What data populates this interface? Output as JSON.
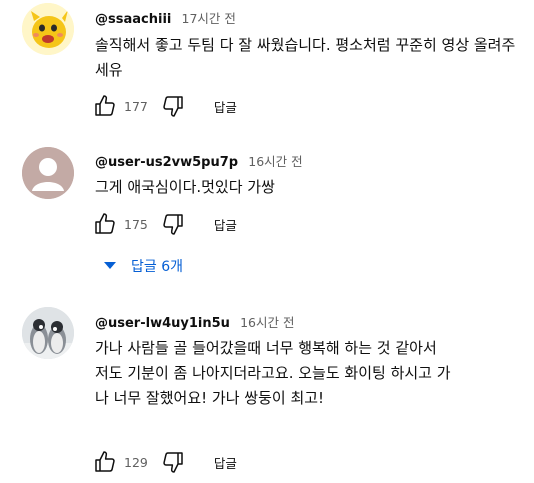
{
  "colors": {
    "link": "#065fd4",
    "secondary": "#606060",
    "text": "#0f0f0f"
  },
  "comments": [
    {
      "author": "@ssaachiii",
      "time": "17시간 전",
      "text": "솔직해서 좋고 두팀 다 잘 싸웠습니다. 평소처럼 꾸준히 영상 올려주세유",
      "likes": "177",
      "reply_label": "답글",
      "avatar": "cartoon-avatar"
    },
    {
      "author": "@user-us2vw5pu7p",
      "time": "16시간 전",
      "text": "그게 애국심이다.멋있다 가쌍",
      "likes": "175",
      "reply_label": "답글",
      "avatar": "default-avatar",
      "replies_toggle": "답글 6개"
    },
    {
      "author": "@user-lw4uy1in5u",
      "time": "16시간 전",
      "text": "가나 사람들 골 들어갔을때 너무 행복해 하는 것 같아서 저도 기분이 좀 나아지더라고요. 오늘도 화이팅 하시고 가나 너무 잘했어요! 가나 쌍둥이 최고!",
      "likes": "129",
      "reply_label": "답글",
      "avatar": "penguin-avatar"
    }
  ]
}
